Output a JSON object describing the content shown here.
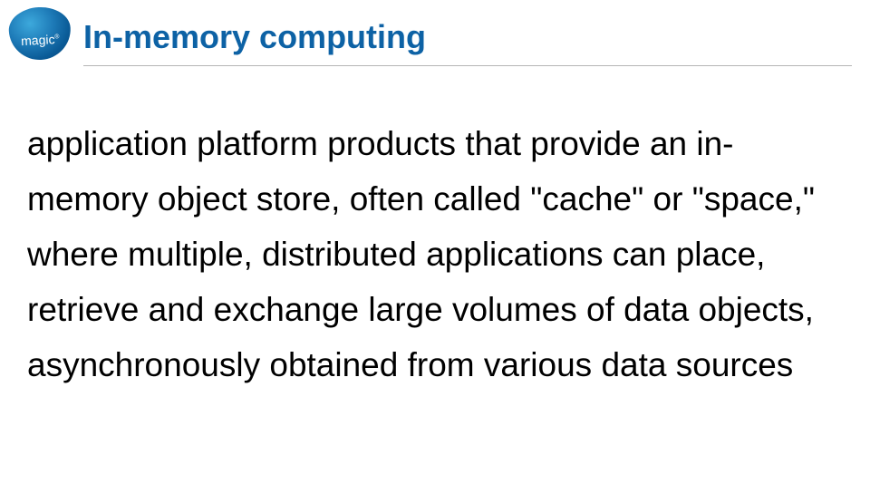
{
  "logo": {
    "brand": "magic",
    "tm": "®"
  },
  "header": {
    "title": "In-memory computing"
  },
  "content": {
    "paragraph": "application platform products that provide an in-memory object store, often called \"cache\" or \"space,\" where multiple, distributed applications can place, retrieve and exchange large volumes of data objects, asynchronously obtained from various data sources"
  }
}
